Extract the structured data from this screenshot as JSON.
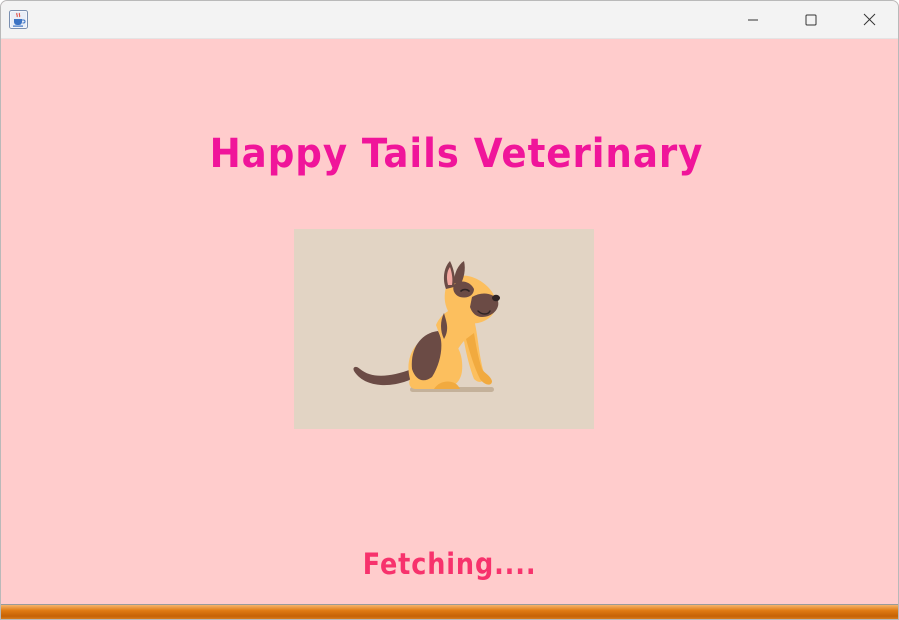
{
  "window": {
    "icon": "java-cup-icon",
    "controls": [
      "minimize-icon",
      "maximize-icon",
      "close-icon"
    ]
  },
  "main": {
    "title": "Happy Tails Veterinary",
    "status": "Fetching....",
    "image": "sitting-dog-illustration"
  },
  "progress": {
    "value_fraction": 1.0
  },
  "colors": {
    "background": "#ffcccc",
    "title": "#f0159a",
    "status": "#f7326c",
    "progress": "#e07a12",
    "image_bg": "#e2d4c4"
  }
}
